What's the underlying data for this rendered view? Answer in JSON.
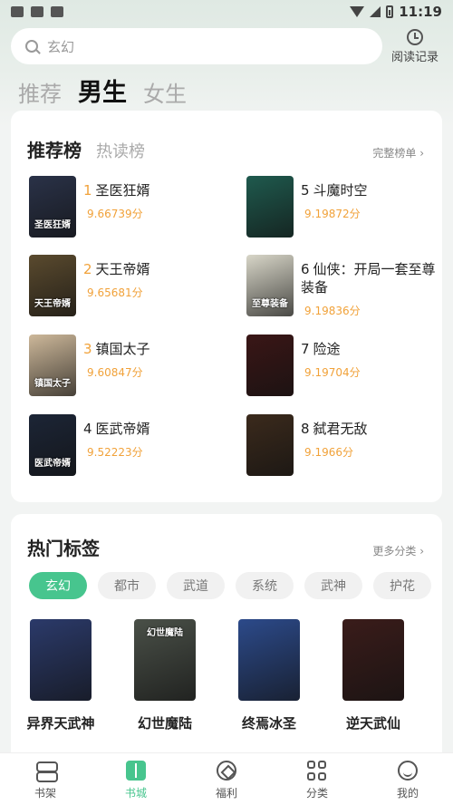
{
  "status_bar": {
    "time": "11:19"
  },
  "search": {
    "placeholder": "玄幻",
    "history_label": "阅读记录"
  },
  "gender_tabs": [
    {
      "label": "推荐",
      "active": false
    },
    {
      "label": "男生",
      "active": true
    },
    {
      "label": "女生",
      "active": false
    }
  ],
  "ranking": {
    "title": "推荐榜",
    "tab2": "热读榜",
    "more": "完整榜单 ›",
    "items": [
      {
        "rank": "1",
        "title": "圣医狂婿",
        "score": "9.66739分",
        "cover_text": "圣医狂婿",
        "cover_color": "#2a3248"
      },
      {
        "rank": "2",
        "title": "天王帝婿",
        "score": "9.65681分",
        "cover_text": "天王帝婿",
        "cover_color": "#5a4a2e"
      },
      {
        "rank": "3",
        "title": "镇国太子",
        "score": "9.60847分",
        "cover_text": "镇国太子",
        "cover_color": "#cdb89a"
      },
      {
        "rank": "4",
        "title": "医武帝婿",
        "score": "9.52223分",
        "cover_text": "医武帝婿",
        "cover_color": "#1c2536"
      },
      {
        "rank": "5",
        "title": "斗魔时空",
        "score": "9.19872分",
        "cover_text": "",
        "cover_color": "#1f5a4e"
      },
      {
        "rank": "6",
        "title": "仙侠：开局一套至尊装备",
        "score": "9.19836分",
        "cover_text": "至尊装备",
        "cover_color": "#d8d6c8"
      },
      {
        "rank": "7",
        "title": "险途",
        "score": "9.19704分",
        "cover_text": "",
        "cover_color": "#3a1616"
      },
      {
        "rank": "8",
        "title": "弑君无敌",
        "score": "9.1966分",
        "cover_text": "",
        "cover_color": "#3b2a1c"
      }
    ]
  },
  "hot_tags": {
    "title": "热门标签",
    "more": "更多分类 ›",
    "tags": [
      {
        "label": "玄幻",
        "active": true
      },
      {
        "label": "都市",
        "active": false
      },
      {
        "label": "武道",
        "active": false
      },
      {
        "label": "系统",
        "active": false
      },
      {
        "label": "武神",
        "active": false
      },
      {
        "label": "护花",
        "active": false
      }
    ],
    "books": [
      {
        "title": "异界天武神",
        "cover_text": "",
        "cover_color": "#2b3a6a"
      },
      {
        "title": "幻世魔陆",
        "cover_text": "幻世魔陆",
        "cover_color": "#4a5048"
      },
      {
        "title": "终焉冰圣",
        "cover_text": "",
        "cover_color": "#2c4a8a"
      },
      {
        "title": "逆天武仙",
        "cover_text": "",
        "cover_color": "#3a1c1a"
      }
    ]
  },
  "bottom_nav": [
    {
      "label": "书架",
      "icon": "shelf-icon",
      "active": false
    },
    {
      "label": "书城",
      "icon": "store-icon",
      "active": true
    },
    {
      "label": "福利",
      "icon": "welfare-icon",
      "active": false
    },
    {
      "label": "分类",
      "icon": "category-icon",
      "active": false
    },
    {
      "label": "我的",
      "icon": "profile-icon",
      "active": false
    }
  ],
  "colors": {
    "accent": "#47c58e",
    "score": "#f1a23a"
  }
}
